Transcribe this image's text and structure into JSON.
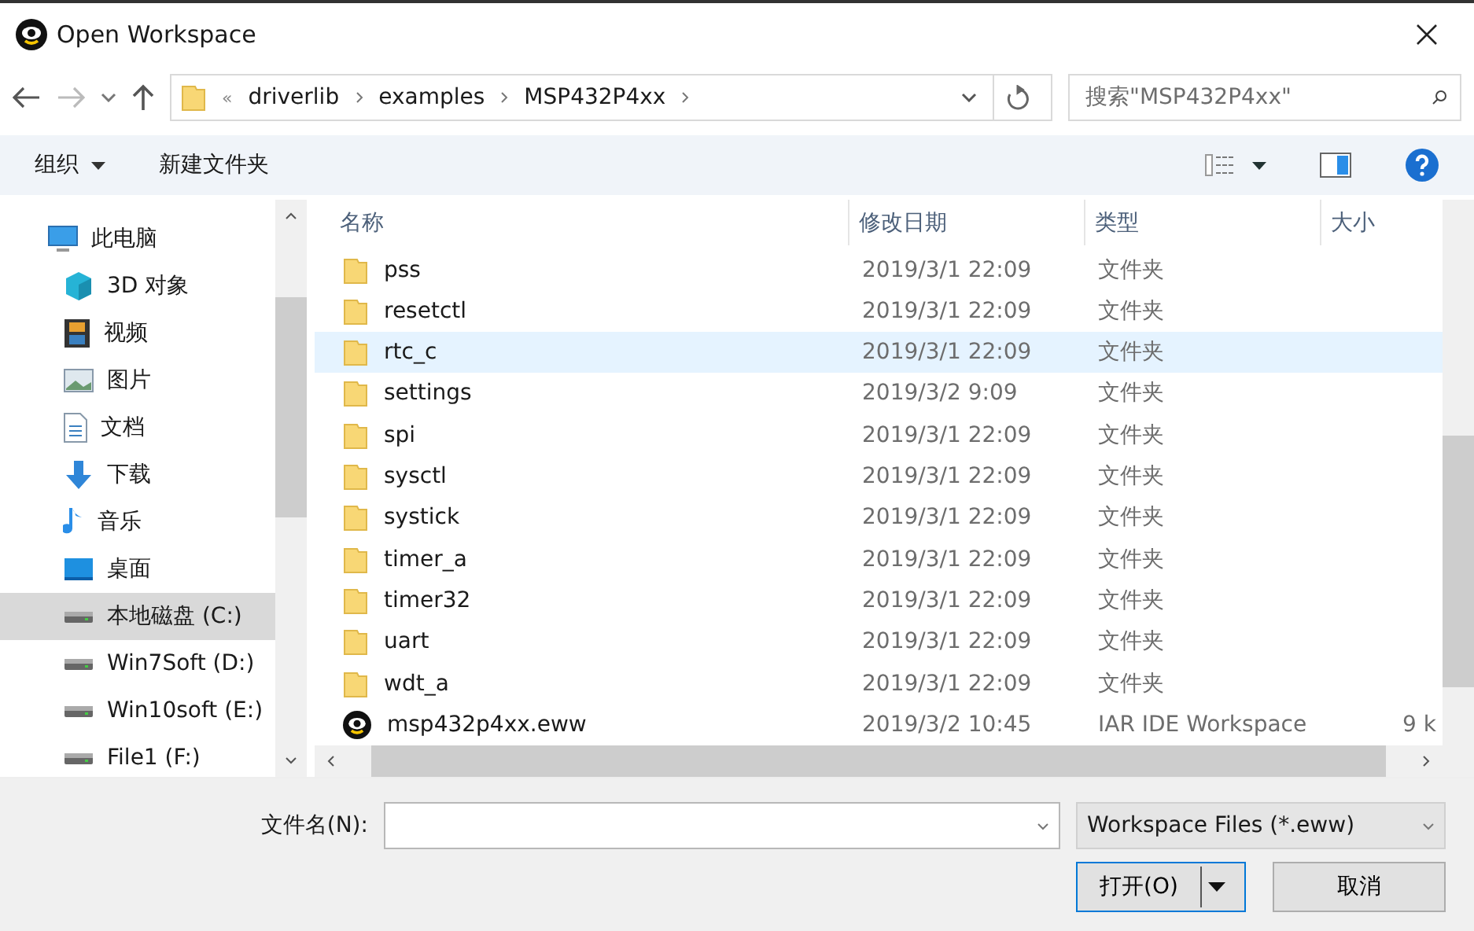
{
  "window": {
    "title": "Open Workspace"
  },
  "address_bar": {
    "overflow": "«",
    "crumbs": [
      "driverlib",
      "examples",
      "MSP432P4xx"
    ]
  },
  "search": {
    "placeholder": "搜索\"MSP432P4xx\""
  },
  "toolbar": {
    "organize": "组织",
    "new_folder": "新建文件夹"
  },
  "sidebar": {
    "items": [
      {
        "label": "此电脑",
        "kind": "pc",
        "selected": false,
        "children": [
          {
            "label": "3D 对象",
            "kind": "cube",
            "selected": false
          },
          {
            "label": "视频",
            "kind": "video",
            "selected": false
          },
          {
            "label": "图片",
            "kind": "picture",
            "selected": false
          },
          {
            "label": "文档",
            "kind": "document",
            "selected": false
          },
          {
            "label": "下载",
            "kind": "download",
            "selected": false
          },
          {
            "label": "音乐",
            "kind": "music",
            "selected": false
          },
          {
            "label": "桌面",
            "kind": "desktop",
            "selected": false
          },
          {
            "label": "本地磁盘 (C:)",
            "kind": "drive",
            "selected": true
          },
          {
            "label": "Win7Soft (D:)",
            "kind": "drive",
            "selected": false
          },
          {
            "label": "Win10soft (E:)",
            "kind": "drive",
            "selected": false
          },
          {
            "label": "File1 (F:)",
            "kind": "drive",
            "selected": false
          }
        ]
      }
    ]
  },
  "table": {
    "columns": [
      "名称",
      "修改日期",
      "类型",
      "大小"
    ],
    "rows": [
      {
        "kind": "folder",
        "name": "pss",
        "date": "2019/3/1 22:09",
        "type": "文件夹",
        "selected": false
      },
      {
        "kind": "folder",
        "name": "resetctl",
        "date": "2019/3/1 22:09",
        "type": "文件夹",
        "selected": false
      },
      {
        "kind": "folder",
        "name": "rtc_c",
        "date": "2019/3/1 22:09",
        "type": "文件夹",
        "selected": true
      },
      {
        "kind": "folder",
        "name": "settings",
        "date": "2019/3/2 9:09",
        "type": "文件夹",
        "selected": false
      },
      {
        "kind": "folder",
        "name": "spi",
        "date": "2019/3/1 22:09",
        "type": "文件夹",
        "selected": false
      },
      {
        "kind": "folder",
        "name": "sysctl",
        "date": "2019/3/1 22:09",
        "type": "文件夹",
        "selected": false
      },
      {
        "kind": "folder",
        "name": "systick",
        "date": "2019/3/1 22:09",
        "type": "文件夹",
        "selected": false
      },
      {
        "kind": "folder",
        "name": "timer_a",
        "date": "2019/3/1 22:09",
        "type": "文件夹",
        "selected": false
      },
      {
        "kind": "folder",
        "name": "timer32",
        "date": "2019/3/1 22:09",
        "type": "文件夹",
        "selected": false
      },
      {
        "kind": "folder",
        "name": "uart",
        "date": "2019/3/1 22:09",
        "type": "文件夹",
        "selected": false
      },
      {
        "kind": "folder",
        "name": "wdt_a",
        "date": "2019/3/1 22:09",
        "type": "文件夹",
        "selected": false
      },
      {
        "kind": "workspace",
        "name": "msp432p4xx.eww",
        "date": "2019/3/2 10:45",
        "type": "IAR IDE Workspace",
        "size": "9 k",
        "selected": false
      }
    ]
  },
  "footer": {
    "filename_label": "文件名(N):",
    "filter": "Workspace Files (*.eww)",
    "open": "打开(O)",
    "cancel": "取消"
  }
}
